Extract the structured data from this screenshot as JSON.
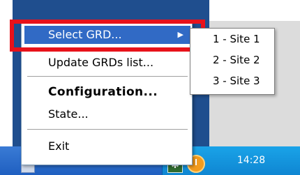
{
  "menu": {
    "items": [
      {
        "label": "Select GRD...",
        "selected": true,
        "has_submenu": true
      },
      {
        "label": "Update GRDs list..."
      },
      {
        "label": "Configuration...",
        "bold": true
      },
      {
        "label": "State..."
      },
      {
        "label": "Exit"
      }
    ],
    "submenu_arrow": "▶"
  },
  "submenu": {
    "items": [
      {
        "label": "1 - Site 1"
      },
      {
        "label": "2 - Site 2"
      },
      {
        "label": "3 - Site 3"
      }
    ]
  },
  "taskbar": {
    "clock": "14:28",
    "tray_icons": [
      "grd-app-icon",
      "clock-icon"
    ]
  },
  "colors": {
    "selection": "#316ac5",
    "highlight_box": "#e8121a",
    "taskbar": "#1f5fc0",
    "tray": "#0f86d2"
  }
}
